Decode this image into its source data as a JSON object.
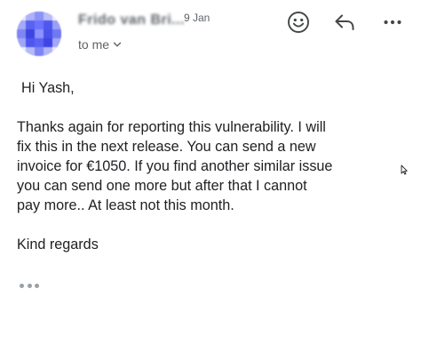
{
  "header": {
    "sender_name": "Frido van Bri...",
    "date": "9 Jan",
    "recipient_label": "to me",
    "icons": {
      "emoji": "emoji-smile-icon",
      "reply": "reply-arrow-icon",
      "more": "more-horizontal-icon",
      "dropdown": "chevron-down-icon"
    }
  },
  "message": {
    "greeting": "Hi Yash,",
    "body_lines": [
      "Thanks again for reporting this vulnerability. I will",
      "fix this in the next release. You can send a new",
      "invoice for €1050. If you find another similar issue",
      "you can send one more but after that I cannot",
      "pay more.. At least not this month."
    ],
    "signoff": "Kind regards"
  },
  "colors": {
    "avatar": "#4b55f2",
    "secondary_text": "#5f6368",
    "body_text": "#202124"
  }
}
